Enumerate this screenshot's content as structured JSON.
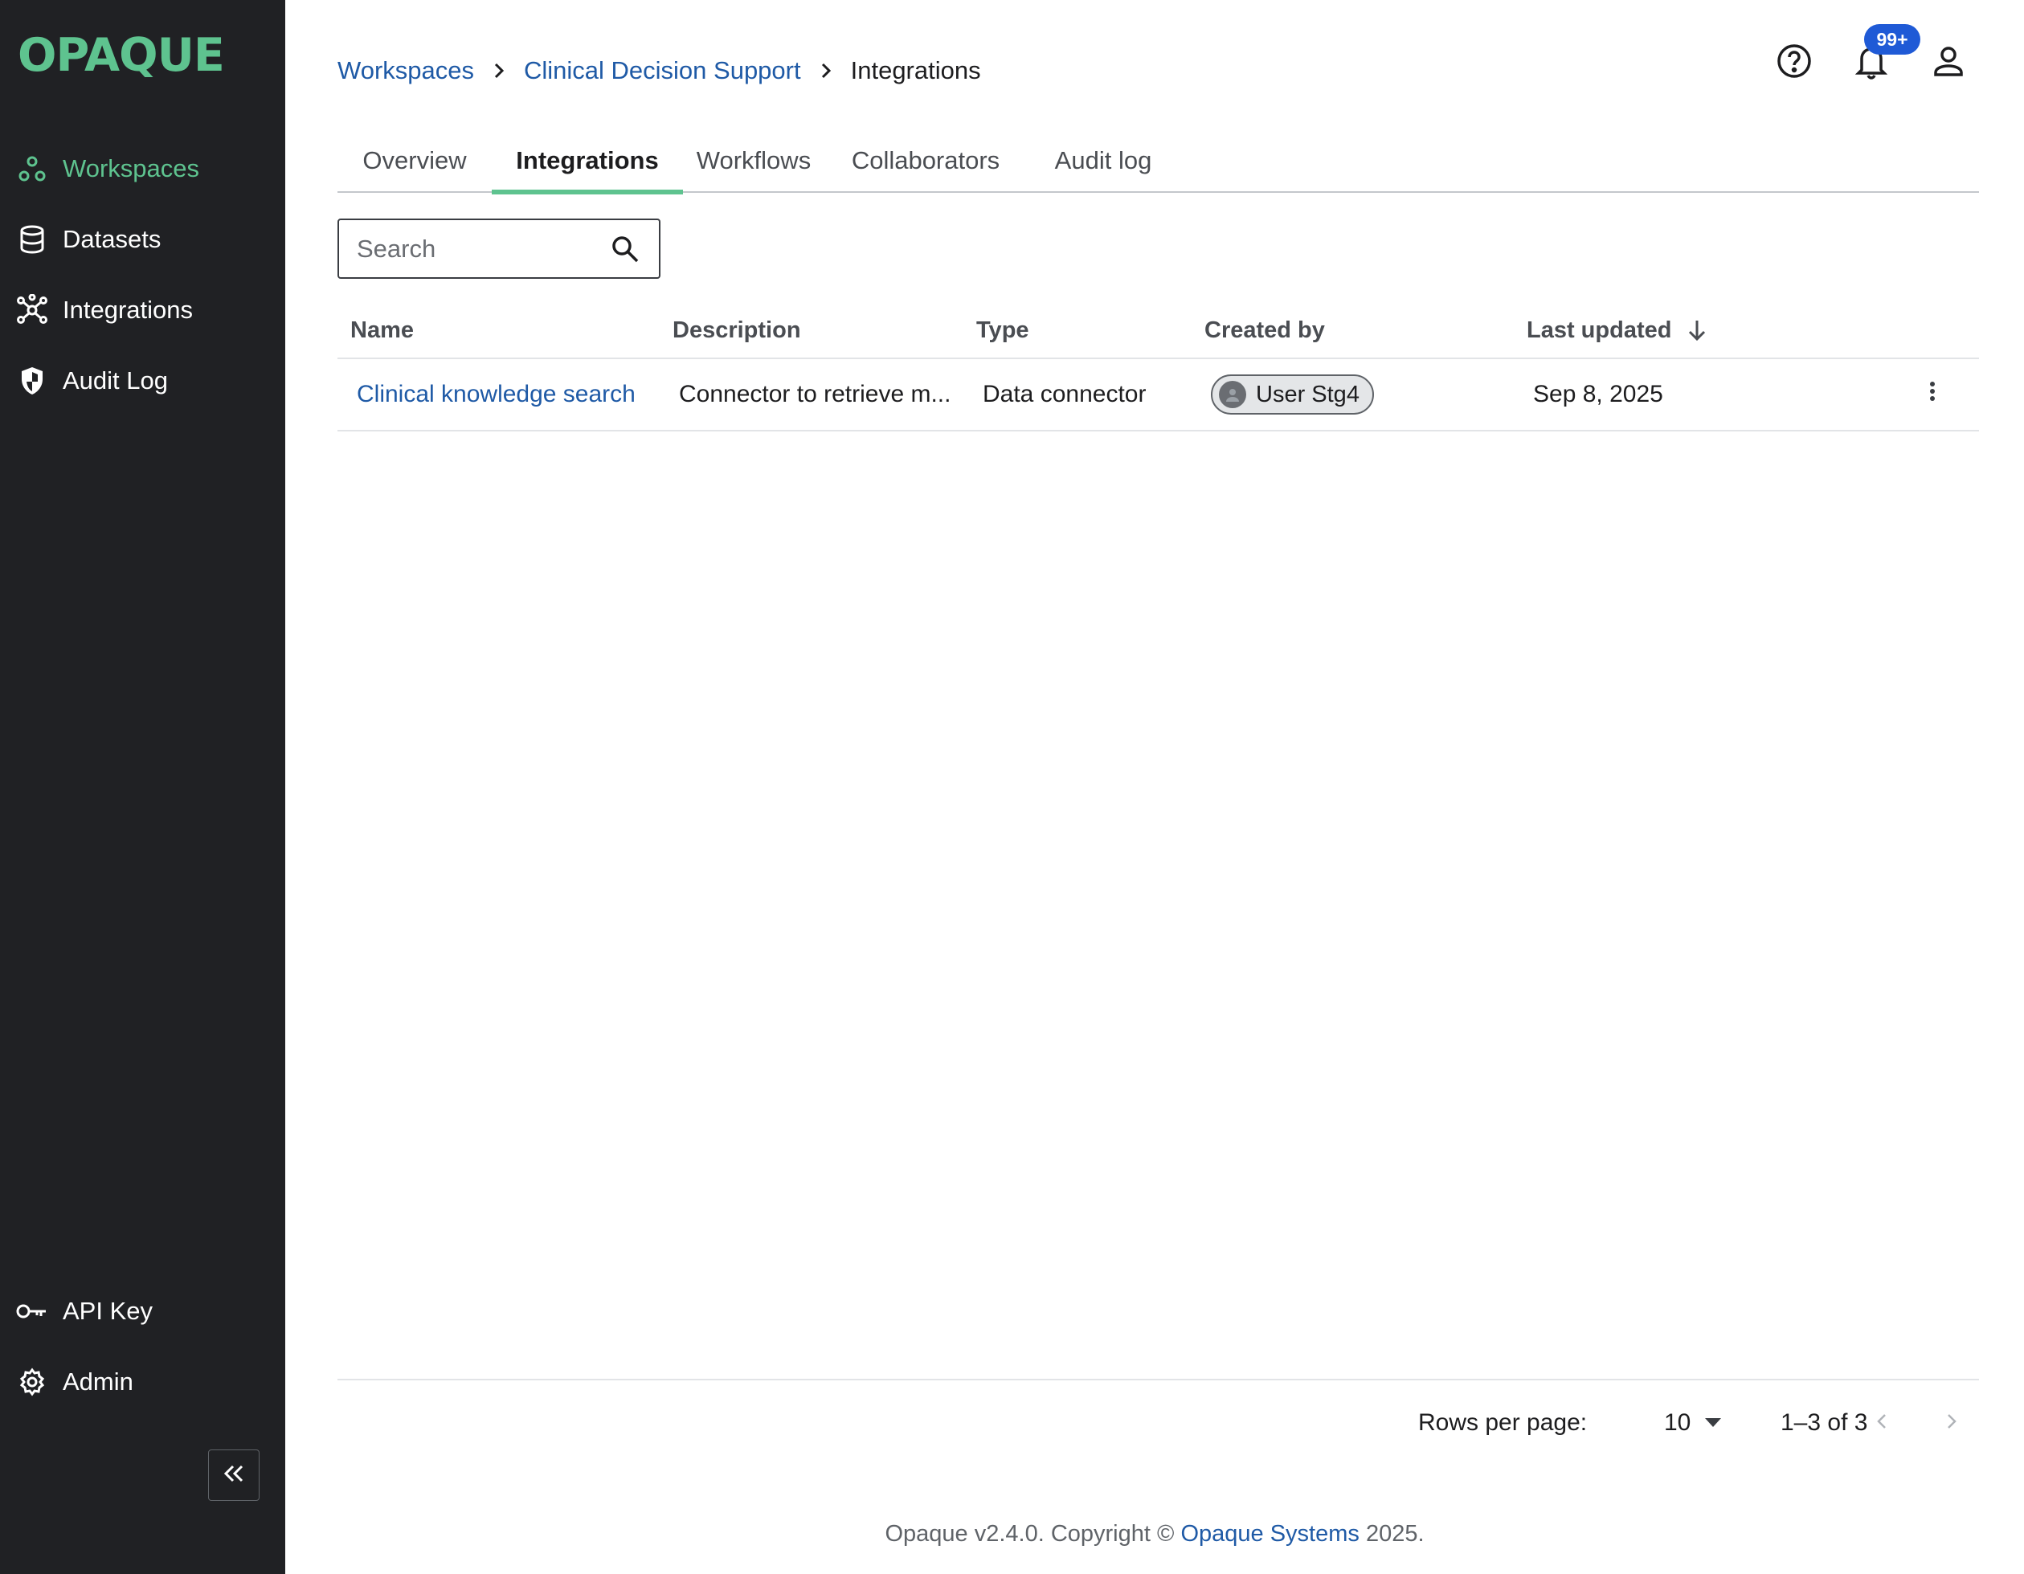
{
  "app": {
    "logo_text": "OPAQUE",
    "accent_color": "#5ec38f",
    "link_color": "#1f5aa6"
  },
  "sidebar": {
    "items": [
      {
        "label": "Workspaces",
        "icon": "workspaces-icon",
        "active": true
      },
      {
        "label": "Datasets",
        "icon": "database-icon",
        "active": false
      },
      {
        "label": "Integrations",
        "icon": "integrations-hub-icon",
        "active": false
      },
      {
        "label": "Audit Log",
        "icon": "shield-icon",
        "active": false
      }
    ],
    "bottom_items": [
      {
        "label": "API Key",
        "icon": "key-icon"
      },
      {
        "label": "Admin",
        "icon": "gear-icon"
      }
    ],
    "collapse_icon": "double-chevron-left-icon"
  },
  "breadcrumb": {
    "workspaces": "Workspaces",
    "workspace": "Clinical Decision Support",
    "current": "Integrations"
  },
  "header": {
    "notification_badge": "99+",
    "icons": [
      "help-icon",
      "bell-icon",
      "account-icon"
    ]
  },
  "tabs": [
    {
      "label": "Overview",
      "active": false
    },
    {
      "label": "Integrations",
      "active": true
    },
    {
      "label": "Workflows",
      "active": false
    },
    {
      "label": "Collaborators",
      "active": false
    },
    {
      "label": "Audit log",
      "active": false
    }
  ],
  "search": {
    "placeholder": "Search",
    "value": ""
  },
  "table": {
    "columns": [
      "Name",
      "Description",
      "Type",
      "Created by",
      "Last updated"
    ],
    "sort_column": "Last updated",
    "sort_direction": "descending",
    "rows": [
      {
        "name": "Clinical knowledge search",
        "description": "Connector to retrieve m...",
        "type": "Data connector",
        "created_by": "User Stg4",
        "last_updated": "Sep 8, 2025"
      }
    ]
  },
  "pagination": {
    "rows_per_page_label": "Rows per page:",
    "rows_per_page": "10",
    "range": "1–3 of 3"
  },
  "footer": {
    "prefix": "Opaque v2.4.0. Copyright ©",
    "company": "Opaque Systems",
    "suffix": "2025."
  }
}
